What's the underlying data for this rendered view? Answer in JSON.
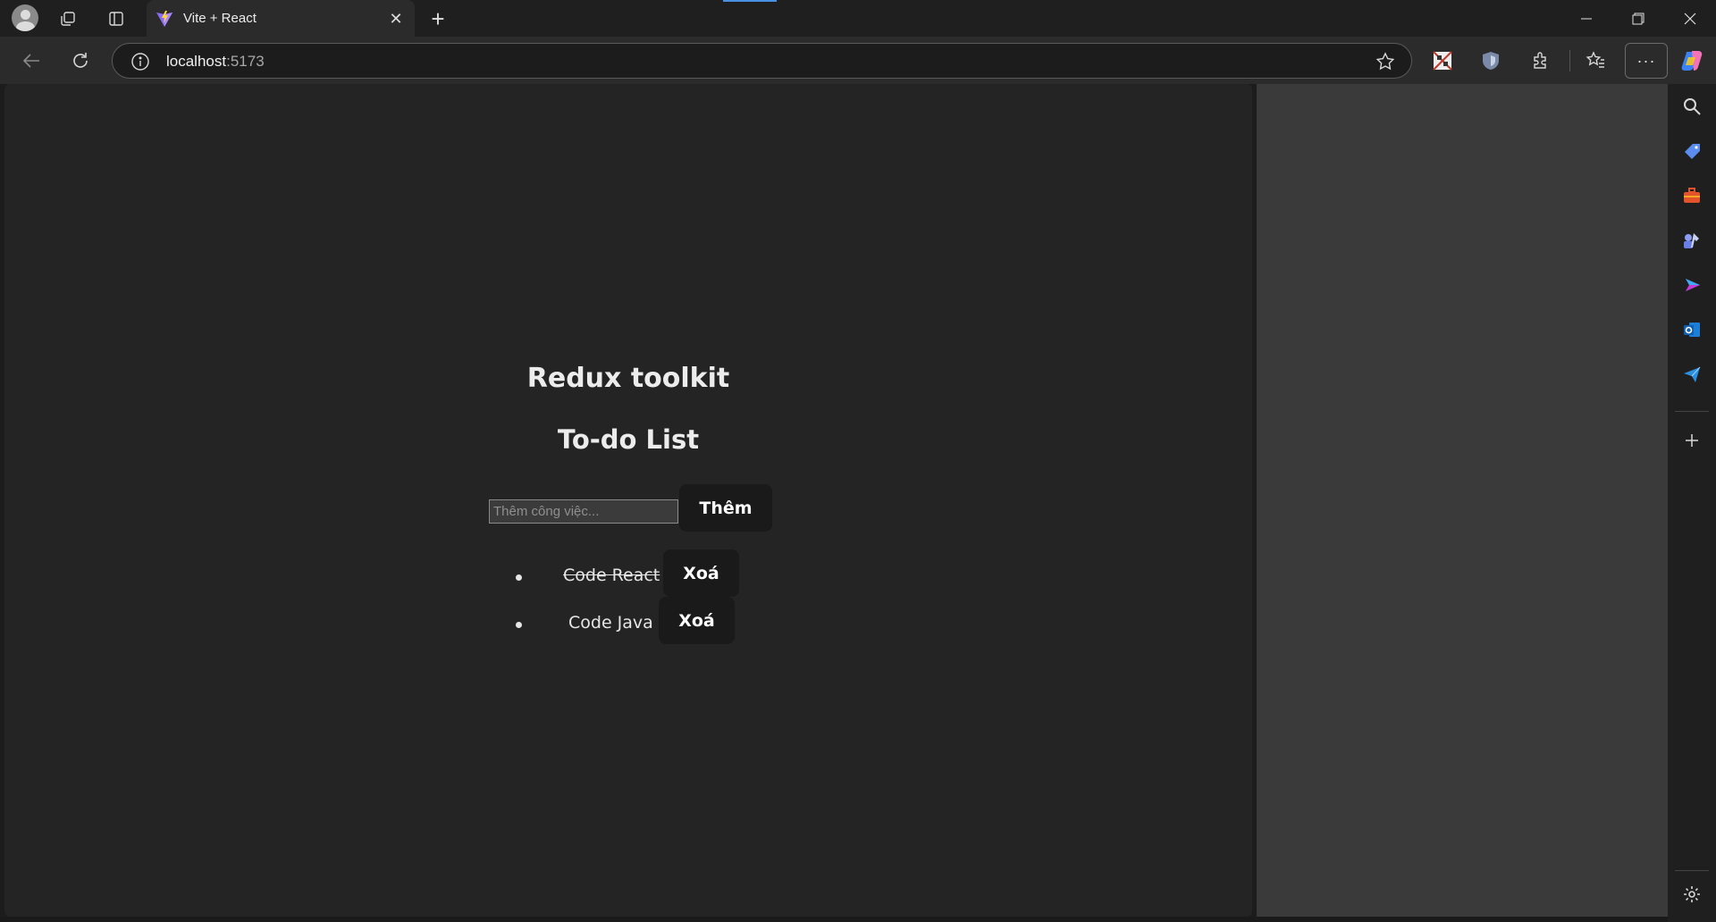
{
  "browser": {
    "tab_title": "Vite + React",
    "url_host": "localhost",
    "url_port": ":5173"
  },
  "app": {
    "heading": "Redux toolkit",
    "subheading": "To-do List",
    "input_placeholder": "Thêm công việc...",
    "add_label": "Thêm",
    "todos": [
      {
        "text": "Code React",
        "completed": true,
        "delete_label": "Xoá"
      },
      {
        "text": "Code Java",
        "completed": false,
        "delete_label": "Xoá"
      }
    ]
  }
}
